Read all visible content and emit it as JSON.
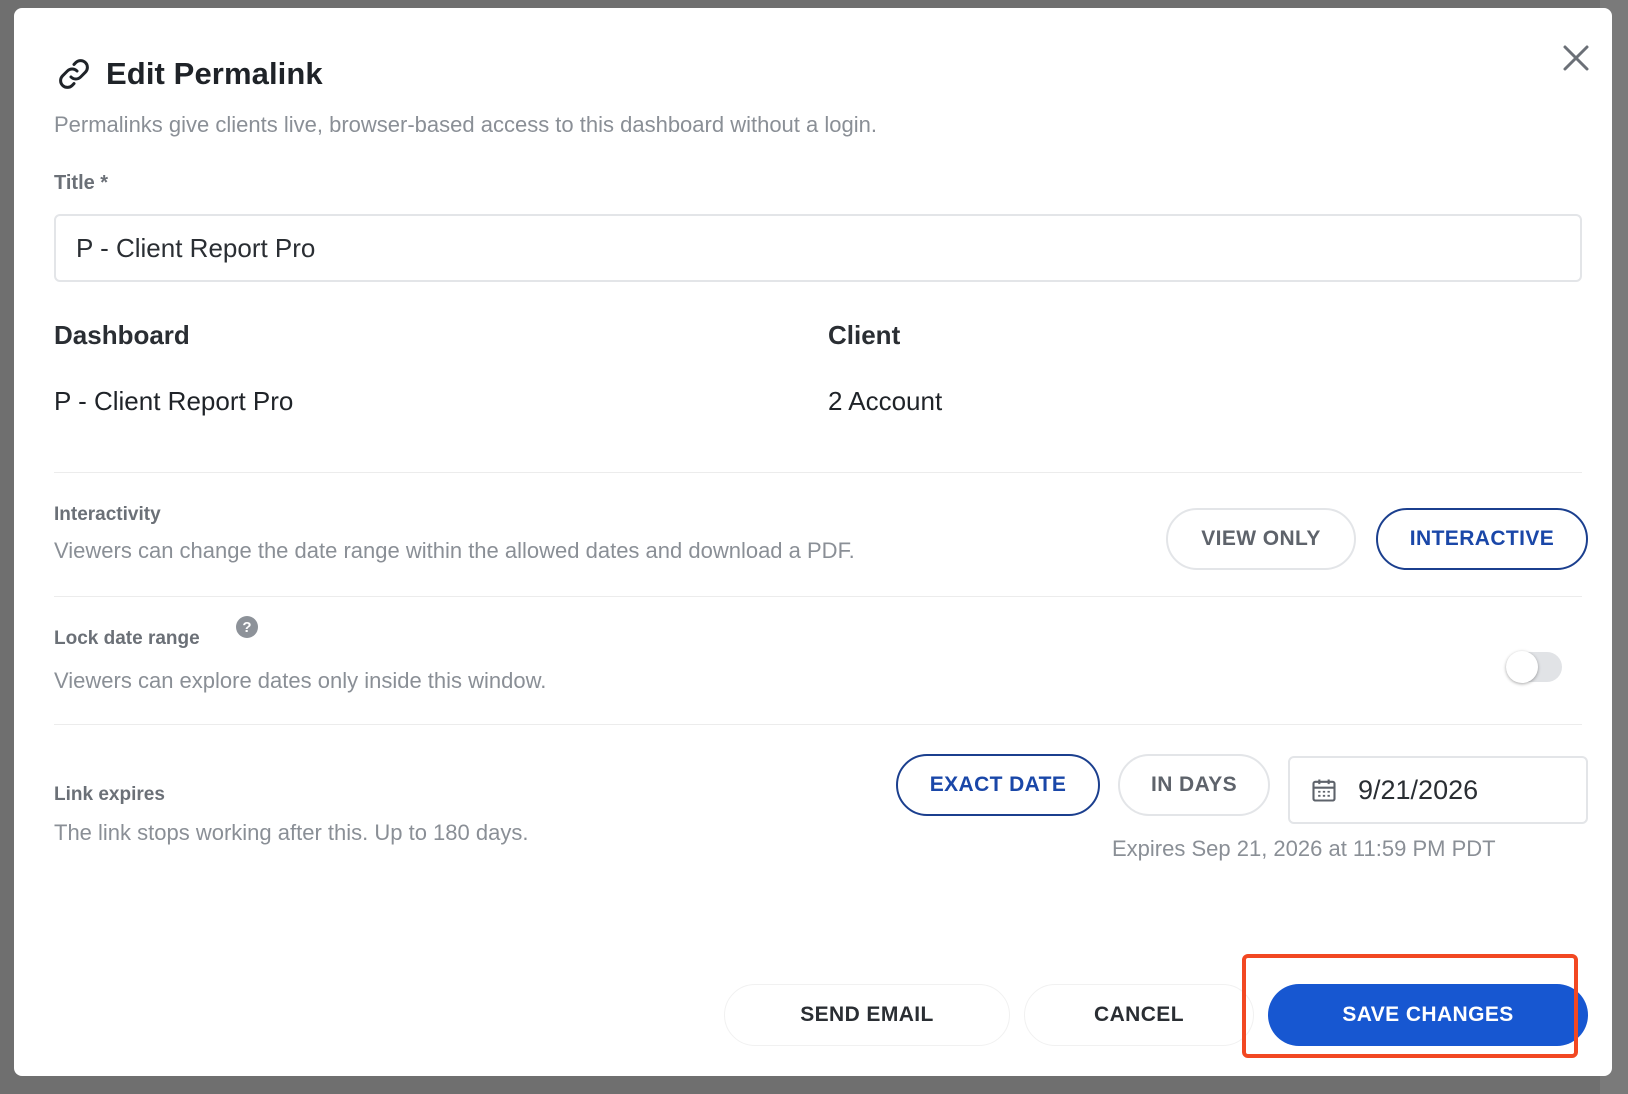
{
  "modal": {
    "title": "Edit Permalink",
    "subtitle": "Permalinks give clients live, browser-based access to this dashboard without a login."
  },
  "title_field": {
    "label": "Title *",
    "value": "P - Client Report Pro"
  },
  "dashboard": {
    "label": "Dashboard",
    "value": "P - Client Report Pro"
  },
  "client": {
    "label": "Client",
    "value": "2 Account"
  },
  "interactivity": {
    "label": "Interactivity",
    "description": "Viewers can change the date range within the allowed dates and download a PDF.",
    "options": [
      "VIEW ONLY",
      "INTERACTIVE"
    ],
    "selected": "INTERACTIVE"
  },
  "lock_date_range": {
    "label": "Lock date range",
    "help": "?",
    "description": "Viewers can explore dates only inside this window.",
    "enabled": false
  },
  "link_expires": {
    "label": "Link expires",
    "description": "The link stops working after this. Up to 180 days.",
    "options": [
      "EXACT DATE",
      "IN DAYS"
    ],
    "selected": "EXACT DATE",
    "date_value": "9/21/2026",
    "note": "Expires Sep 21, 2026 at 11:59 PM PDT"
  },
  "footer": {
    "send_email": "SEND EMAIL",
    "cancel": "CANCEL",
    "save": "SAVE CHANGES"
  },
  "colors": {
    "primary": "#1757d1",
    "selected_outline": "#1b3f8e",
    "highlight": "#f24822"
  }
}
